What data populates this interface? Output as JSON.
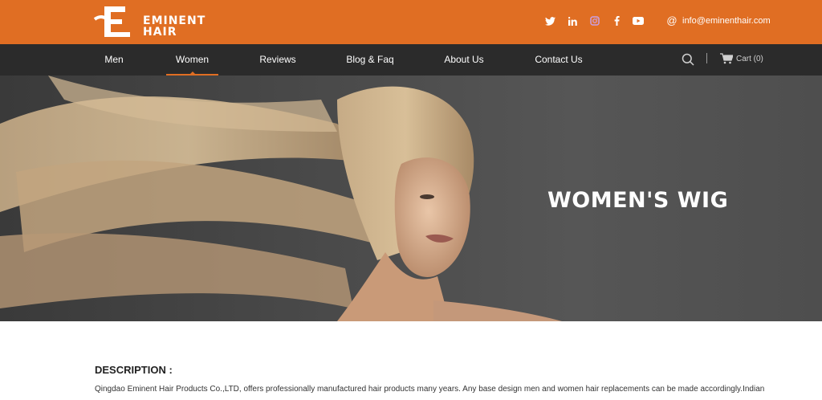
{
  "brand": {
    "logo_text_line1": "EMINENT",
    "logo_text_line2": "HAIR",
    "logo_letter": "E"
  },
  "header": {
    "social": [
      "twitter-icon",
      "linkedin-icon",
      "instagram-icon",
      "facebook-icon",
      "youtube-icon"
    ],
    "email": "info@eminenthair.com"
  },
  "nav": {
    "items": [
      {
        "label": "Men"
      },
      {
        "label": "Women"
      },
      {
        "label": "Reviews"
      },
      {
        "label": "Blog & Faq"
      },
      {
        "label": "About Us"
      },
      {
        "label": "Contact Us"
      }
    ],
    "active": "Women",
    "cart_label": "Cart (0)"
  },
  "hero": {
    "title": "WOMEN'S WIG"
  },
  "description": {
    "title": "DESCRIPTION :",
    "text": "Qingdao Eminent Hair Products Co.,LTD, offers professionally manufactured hair products many years. Any base design men and women hair replacements can be made accordingly.Indian"
  },
  "colors": {
    "brand_orange": "#e06e23",
    "nav_bg": "#2b2b2b"
  }
}
